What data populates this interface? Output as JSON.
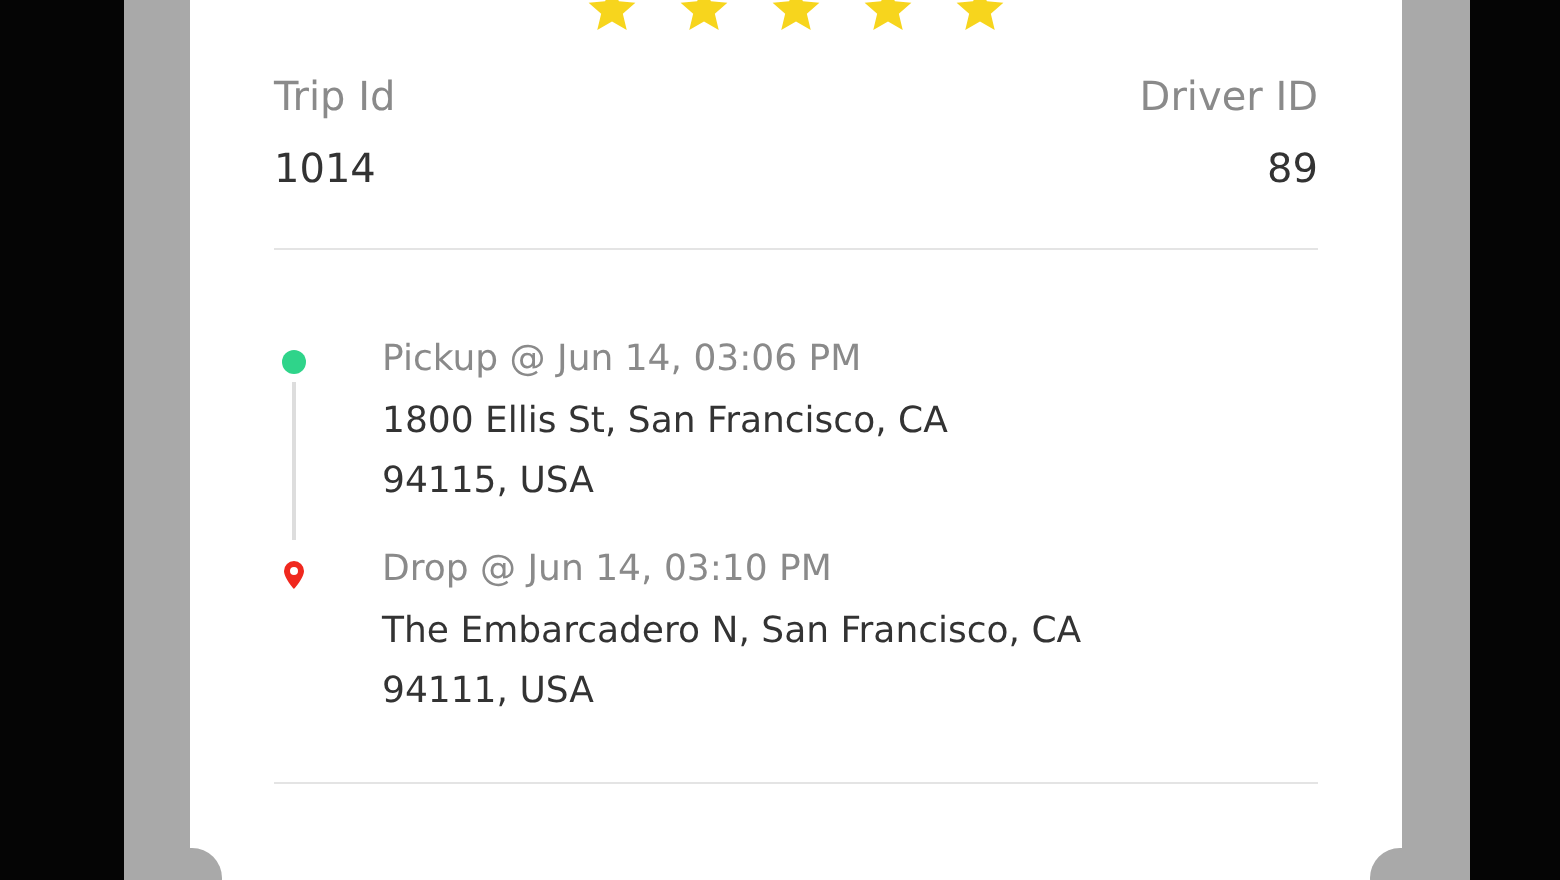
{
  "rating": {
    "stars": 5
  },
  "trip": {
    "trip_id_label": "Trip Id",
    "trip_id": "1014",
    "driver_id_label": "Driver ID",
    "driver_id": "89"
  },
  "stops": [
    {
      "kind": "pickup",
      "title": "Pickup @ Jun 14, 03:06 PM",
      "address": "1800 Ellis St, San Francisco, CA\n94115, USA"
    },
    {
      "kind": "drop",
      "title": "Drop @ Jun 14, 03:10 PM",
      "address": "The Embarcadero N, San Francisco, CA\n94111, USA"
    }
  ]
}
